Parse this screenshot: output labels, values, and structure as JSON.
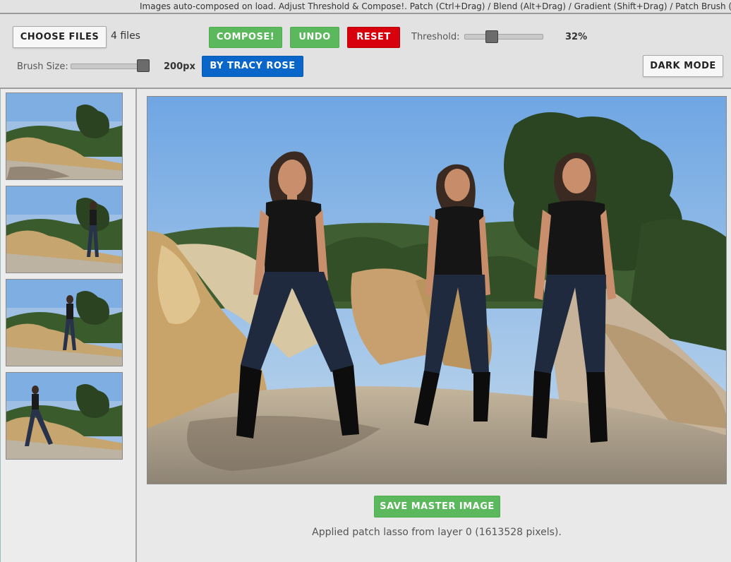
{
  "hint_bar": {
    "text": "Images auto-composed on load. Adjust Threshold & Compose!. Patch (Ctrl+Drag) / Blend (Alt+Drag) / Gradient (Shift+Drag) / Patch Brush (Drag)"
  },
  "toolbar": {
    "choose_files_label": "CHOOSE FILES",
    "file_count": "4 files",
    "compose_label": "COMPOSE!",
    "undo_label": "UNDO",
    "reset_label": "RESET",
    "threshold_label": "Threshold:",
    "threshold_value": "32%",
    "threshold_fraction": 0.32,
    "brush_label": "Brush Size:",
    "brush_value": "200px",
    "brush_fraction": 1.0,
    "credit_label": "BY TRACY ROSE",
    "dark_mode_label": "DARK MODE"
  },
  "sidebar": {
    "thumbnails": [
      {
        "name": "layer-0-thumbnail"
      },
      {
        "name": "layer-1-thumbnail"
      },
      {
        "name": "layer-2-thumbnail"
      },
      {
        "name": "layer-3-thumbnail"
      }
    ]
  },
  "main": {
    "save_label": "SAVE MASTER IMAGE",
    "status_text": "Applied patch lasso from layer 0 (1613528 pixels)."
  },
  "colors": {
    "green": "#5cb85c",
    "red": "#d9000d",
    "blue": "#0a67c9",
    "sky": "#7fb0e6",
    "rock": "#c9a46a",
    "tree": "#2f4a22"
  }
}
